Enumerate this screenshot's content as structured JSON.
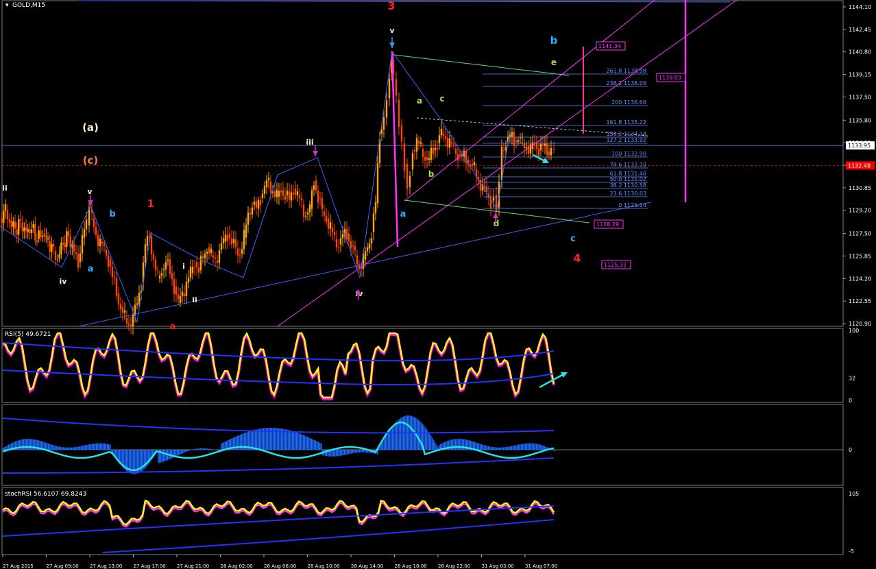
{
  "window_title": "GOLD,M15",
  "colors": {
    "background": "#000000",
    "bull_candle": "#ffa500",
    "bear_candle": "#ff4500",
    "trendline": "#4060ff",
    "channel": "#ff33ff",
    "fib": "#6a8cff",
    "rsi_line": "#ffff00",
    "rsi_shadow": "#ff00ff",
    "macd_hist": "#1e6bff",
    "price_line": "#ff0000"
  },
  "chart_data": [
    {
      "type": "candlestick",
      "name": "main",
      "symbol": "GOLD,M15",
      "ylim": [
        1120.5,
        1144.9
      ],
      "y_ticks": [
        "1144.10",
        "1142.45",
        "1140.80",
        "1139.15",
        "1137.50",
        "1135.80",
        "1134.15",
        "1132.50",
        "1130.85",
        "1129.20",
        "1127.50",
        "1125.85",
        "1124.20",
        "1122.55",
        "1120.90"
      ],
      "x_ticks": [
        "27 Aug 2015",
        "27 Aug 09:00",
        "27 Aug 13:00",
        "27 Aug 17:00",
        "27 Aug 21:00",
        "28 Aug 02:00",
        "28 Aug 06:00",
        "28 Aug 10:00",
        "28 Aug 14:00",
        "28 Aug 18:00",
        "28 Aug 22:00",
        "31 Aug 03:00",
        "31 Aug 07:00"
      ],
      "current_price": "1133.95",
      "bid_line": "1132.48",
      "close_path": [
        [
          0,
          1128.6
        ],
        [
          8,
          1129.2
        ],
        [
          14,
          1128.4
        ],
        [
          22,
          1127.8
        ],
        [
          30,
          1128.3
        ],
        [
          38,
          1127.6
        ],
        [
          46,
          1127.9
        ],
        [
          54,
          1127.1
        ],
        [
          62,
          1127.5
        ],
        [
          70,
          1126.9
        ],
        [
          78,
          1126.2
        ],
        [
          84,
          1125.7
        ],
        [
          92,
          1126.8
        ],
        [
          100,
          1127.3
        ],
        [
          108,
          1126.1
        ],
        [
          114,
          1125.4
        ],
        [
          120,
          1127.2
        ],
        [
          126,
          1128.1
        ],
        [
          130,
          1129.3
        ],
        [
          134,
          1128.6
        ],
        [
          140,
          1127.4
        ],
        [
          146,
          1126.9
        ],
        [
          152,
          1126.3
        ],
        [
          158,
          1125.6
        ],
        [
          164,
          1124.3
        ],
        [
          170,
          1123.1
        ],
        [
          176,
          1122.1
        ],
        [
          182,
          1121.3
        ],
        [
          188,
          1120.8
        ],
        [
          194,
          1121.5
        ],
        [
          200,
          1122.3
        ],
        [
          206,
          1123.9
        ],
        [
          212,
          1126.6
        ],
        [
          218,
          1127.3
        ],
        [
          224,
          1125.6
        ],
        [
          230,
          1124.2
        ],
        [
          236,
          1124.8
        ],
        [
          242,
          1125.5
        ],
        [
          248,
          1124.6
        ],
        [
          254,
          1123.6
        ],
        [
          260,
          1122.4
        ],
        [
          266,
          1123.1
        ],
        [
          272,
          1123.9
        ],
        [
          278,
          1124.6
        ],
        [
          284,
          1125.4
        ],
        [
          290,
          1124.8
        ],
        [
          296,
          1125.7
        ],
        [
          302,
          1126.5
        ],
        [
          308,
          1125.9
        ],
        [
          314,
          1125.5
        ],
        [
          320,
          1126.3
        ],
        [
          326,
          1126.9
        ],
        [
          332,
          1127.5
        ],
        [
          338,
          1126.8
        ],
        [
          344,
          1126.4
        ],
        [
          350,
          1126.0
        ],
        [
          356,
          1127.2
        ],
        [
          362,
          1129.0
        ],
        [
          368,
          1129.6
        ],
        [
          374,
          1129.3
        ],
        [
          380,
          1130.1
        ],
        [
          386,
          1130.9
        ],
        [
          392,
          1131.3
        ],
        [
          398,
          1130.6
        ],
        [
          404,
          1130.2
        ],
        [
          410,
          1130.7
        ],
        [
          416,
          1130.3
        ],
        [
          422,
          1129.9
        ],
        [
          428,
          1130.8
        ],
        [
          434,
          1130.3
        ],
        [
          440,
          1129.6
        ],
        [
          446,
          1128.9
        ],
        [
          452,
          1129.3
        ],
        [
          458,
          1131.4
        ],
        [
          464,
          1130.1
        ],
        [
          470,
          1129.1
        ],
        [
          476,
          1128.6
        ],
        [
          482,
          1127.9
        ],
        [
          488,
          1127.1
        ],
        [
          494,
          1126.7
        ],
        [
          500,
          1127.3
        ],
        [
          506,
          1127.5
        ],
        [
          512,
          1126.6
        ],
        [
          518,
          1125.9
        ],
        [
          524,
          1125.1
        ],
        [
          530,
          1125.6
        ],
        [
          536,
          1126.4
        ],
        [
          542,
          1127.6
        ],
        [
          548,
          1129.7
        ],
        [
          554,
          1134.8
        ],
        [
          560,
          1136.0
        ],
        [
          564,
          1137.4
        ],
        [
          568,
          1139.3
        ],
        [
          571,
          1140.2
        ],
        [
          574,
          1138.8
        ],
        [
          578,
          1137.3
        ],
        [
          582,
          1135.4
        ],
        [
          586,
          1134.1
        ],
        [
          590,
          1132.6
        ],
        [
          594,
          1130.9
        ],
        [
          598,
          1132.2
        ],
        [
          602,
          1133.6
        ],
        [
          608,
          1134.3
        ],
        [
          614,
          1133.7
        ],
        [
          620,
          1133.1
        ],
        [
          626,
          1132.9
        ],
        [
          632,
          1133.6
        ],
        [
          638,
          1134.1
        ],
        [
          644,
          1134.8
        ],
        [
          650,
          1134.5
        ],
        [
          656,
          1134.2
        ],
        [
          662,
          1133.7
        ],
        [
          668,
          1133.3
        ],
        [
          674,
          1133.1
        ],
        [
          680,
          1132.9
        ],
        [
          686,
          1132.6
        ],
        [
          692,
          1132.2
        ],
        [
          698,
          1131.4
        ],
        [
          704,
          1130.9
        ],
        [
          710,
          1130.4
        ],
        [
          716,
          1129.9
        ],
        [
          720,
          1130.3
        ],
        [
          724,
          1129.4
        ],
        [
          728,
          1131.4
        ],
        [
          732,
          1133.6
        ],
        [
          738,
          1134.2
        ],
        [
          744,
          1134.6
        ],
        [
          750,
          1134.3
        ],
        [
          756,
          1134.5
        ],
        [
          762,
          1134.1
        ],
        [
          768,
          1133.9
        ],
        [
          774,
          1133.7
        ],
        [
          780,
          1134.1
        ],
        [
          786,
          1133.6
        ],
        [
          792,
          1133.9
        ],
        [
          798,
          1133.5
        ],
        [
          804,
          1133.7
        ],
        [
          808,
          1133.9
        ]
      ],
      "fib_levels": [
        {
          "label": "261.8 1138.98"
        },
        {
          "label": "238.2 1138.09"
        },
        {
          "label": "200 1136.66"
        },
        {
          "label": "161.8 1135.22"
        },
        {
          "label": "138.2 1134.34"
        },
        {
          "label": "127.2 1133.92"
        },
        {
          "label": "100 1132.90"
        },
        {
          "label": "78.6 1132.10"
        },
        {
          "label": "61.8 1131.46"
        },
        {
          "label": "50.0 1131.02"
        },
        {
          "label": "38.2 1130.58"
        },
        {
          "label": "23.6 1130.03"
        },
        {
          "label": "0 1129.14"
        }
      ],
      "price_boxes": [
        "1141.34",
        "1139.03",
        "1128.29",
        "1125.32"
      ],
      "wave_labels": [
        "3",
        "1",
        "4",
        "(a)",
        "(c)",
        "ii",
        "v",
        "iv",
        "b",
        "a",
        "i",
        "ii",
        "iii",
        "v",
        "iv",
        "a",
        "b",
        "c",
        "a",
        "d",
        "b",
        "e",
        "c",
        "a"
      ]
    },
    {
      "type": "line",
      "name": "rsi",
      "title": "RSI(5) 49.6721",
      "ylim": [
        0,
        100
      ],
      "y_ticks": [
        "100",
        "32",
        "0"
      ]
    },
    {
      "type": "histogram",
      "name": "macd",
      "y_ticks": [
        "0"
      ]
    },
    {
      "type": "line",
      "name": "stochrsi",
      "title": "stochRSI 56.6107 69.8243",
      "y_ticks": [
        "105",
        "-5"
      ]
    }
  ]
}
